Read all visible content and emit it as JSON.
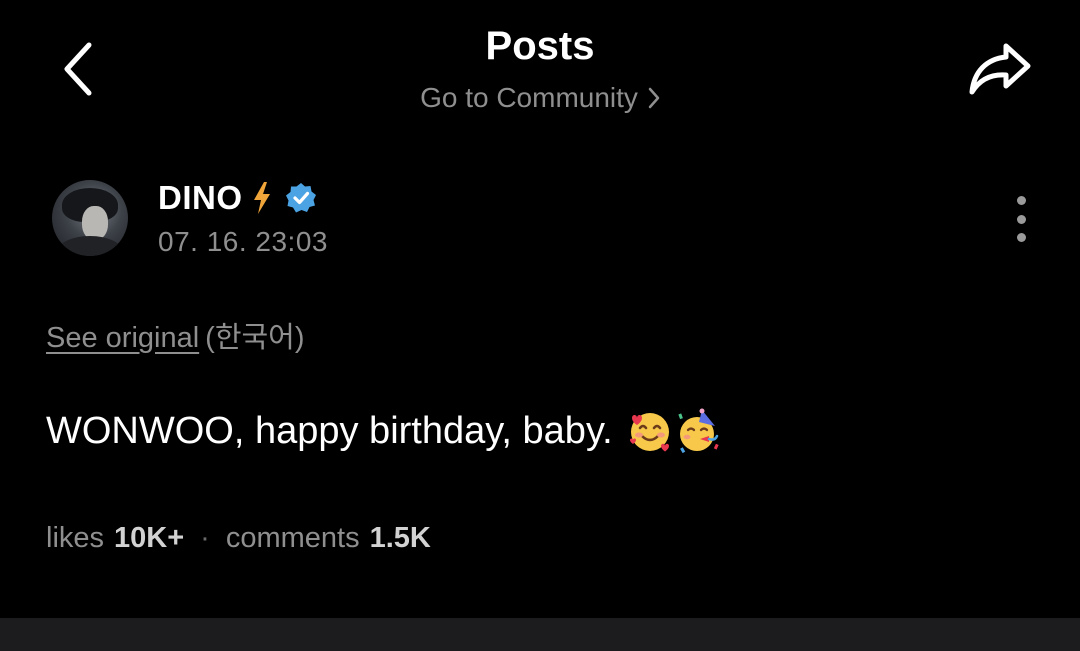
{
  "header": {
    "title": "Posts",
    "community_link": "Go to Community"
  },
  "author": {
    "name": "DINO",
    "timestamp": "07. 16. 23:03"
  },
  "translation": {
    "see_original": "See original",
    "language": "(한국어)"
  },
  "post": {
    "text": "WONWOO, happy birthday, baby."
  },
  "stats": {
    "likes_label": "likes",
    "likes_value": "10K+",
    "separator": "·",
    "comments_label": "comments",
    "comments_value": "1.5K"
  },
  "icons": {
    "back": "chevron-left-icon",
    "share": "share-arrow-icon",
    "community_chevron": "chevron-right-icon",
    "bolt": "lightning-bolt-icon",
    "verified": "verified-badge-icon",
    "more": "more-vertical-icon",
    "emoji_1": "smiling-face-with-hearts-emoji",
    "emoji_2": "partying-face-emoji"
  },
  "colors": {
    "background": "#000000",
    "text_primary": "#ffffff",
    "text_secondary": "#8f8f8f",
    "verified": "#4ba3e3",
    "bolt": "#f0a53a",
    "bottom_bar": "#1c1c1e"
  }
}
